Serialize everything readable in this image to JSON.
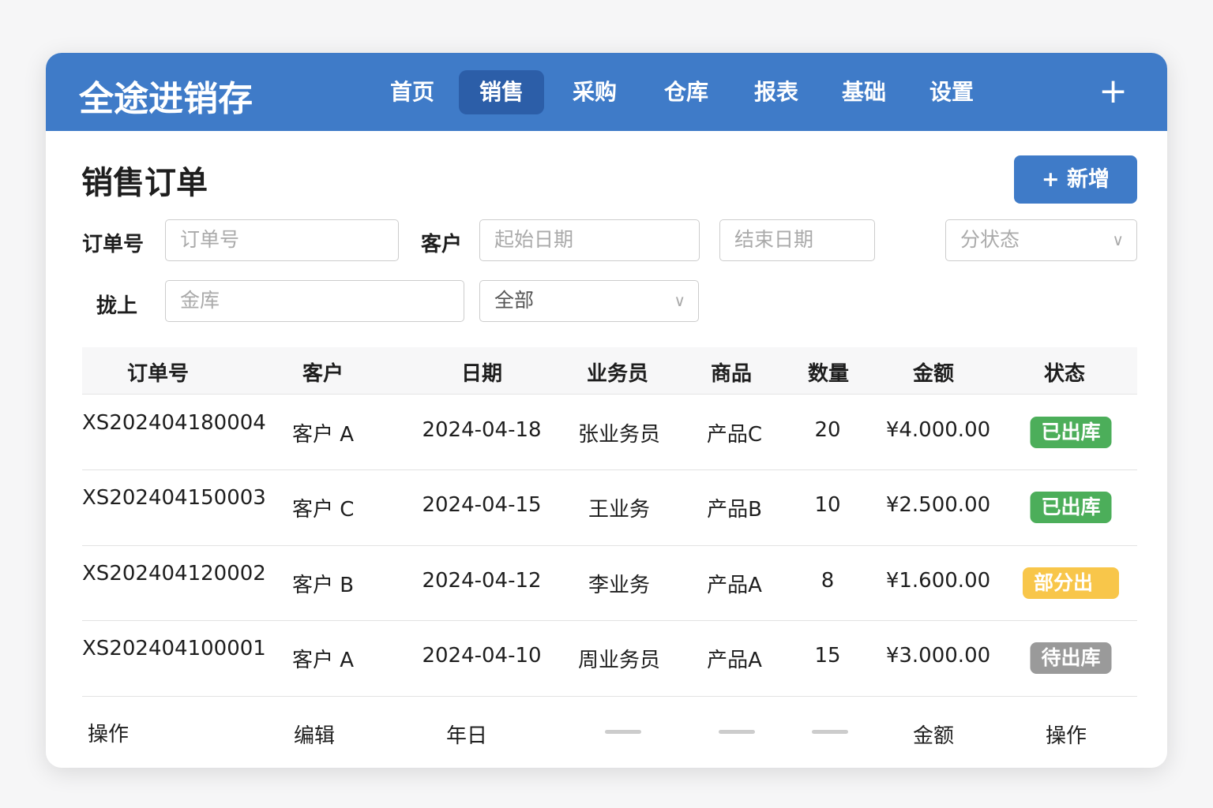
{
  "app_title": "全途进销存",
  "nav": [
    "首页",
    "销售",
    "采购",
    "仓库",
    "报表",
    "基础",
    "设置"
  ],
  "active_nav": "销售",
  "page_title": "销售订单",
  "add_button": "+ 新增",
  "filters": {
    "order_label": "订单号",
    "order_placeholder": "订单号",
    "customer_label": "客户",
    "start_placeholder": "起始日期",
    "end_placeholder": "结束日期",
    "status_placeholder": "分状态",
    "warehouse_label": "拢上",
    "warehouse_placeholder": "金库",
    "dept_value": "全部"
  },
  "table": {
    "headers": [
      "订单号",
      "客户",
      "日期",
      "业务员",
      "商品",
      "数量",
      "金额",
      "状态"
    ],
    "rows": [
      {
        "id": "XS202404180004",
        "customer": "客户 A",
        "date": "2024-04-18",
        "sales": "张业务员",
        "product": "产品C",
        "qty": "20",
        "amount": "¥4.000.00",
        "status": "已出库",
        "status_color": "#4cae5a"
      },
      {
        "id": "XS202404150003",
        "customer": "客户 C",
        "date": "2024-04-15",
        "sales": "王业务",
        "product": "产品B",
        "qty": "10",
        "amount": "¥2.500.00",
        "status": "已出库",
        "status_color": "#4cae5a"
      },
      {
        "id": "XS202404120002",
        "customer": "客户 B",
        "date": "2024-04-12",
        "sales": "李业务",
        "product": "产品A",
        "qty": "8",
        "amount": "¥1.600.00",
        "status": "部分出库",
        "status_color": "#f8c64a"
      },
      {
        "id": "XS202404100001",
        "customer": "客户 A",
        "date": "2024-04-10",
        "sales": "周业务员",
        "product": "产品A",
        "qty": "15",
        "amount": "¥3.000.00",
        "status": "待出库",
        "status_color": "#9a9a9a"
      }
    ],
    "footer": [
      "操作",
      "编辑",
      "年日",
      "金额",
      "操作"
    ]
  },
  "colors": {
    "brand": "#3f7bc8",
    "active": "#2c5ea8"
  }
}
